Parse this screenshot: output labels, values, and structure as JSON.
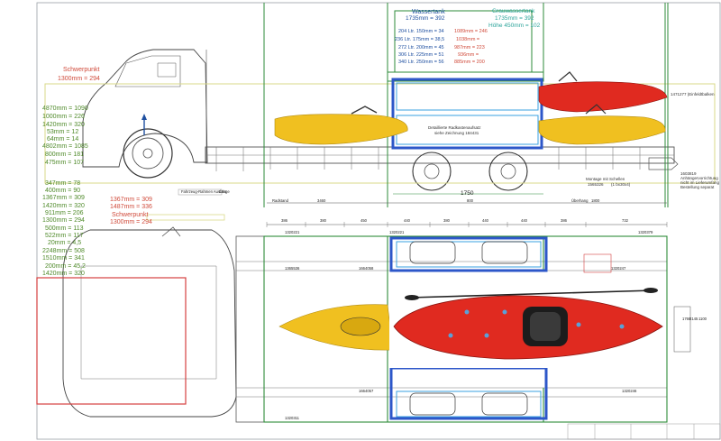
{
  "colors": {
    "frame_green": "#2e8b3a",
    "guide_yellow": "#d9d98a",
    "tank_blue": "#2d57c9",
    "tank_light": "#3aa0e0",
    "kayak_red": "#e02a20",
    "kayak_yellow": "#f0c020",
    "outline_red": "#d64040",
    "label_green": "#4f8a2a",
    "label_red": "#d04a3a",
    "label_teal": "#2aa39a",
    "label_blue": "#1e4fa0"
  },
  "left_labels": {
    "schwerpunkt_top": "Schwerpunkt",
    "schwerpunkt_top_value": "1300mm = 294",
    "list_green": [
      "4870mm = 1090",
      "1000mm = 226",
      "1420mm = 320",
      "53mm = 12",
      "64mm = 14",
      "4802mm = 1085",
      "800mm = 181",
      "475mm = 107"
    ],
    "list_green_lower": [
      "347mm = 78",
      "400mm = 90",
      "1367mm = 309",
      "1420mm = 320",
      "911mm = 206",
      "1300mm = 294",
      "500mm = 113",
      "522mm = 117",
      "20mm = 4,5",
      "2248mm = 508",
      "1510mm = 341",
      "200mm = 45,2",
      "1420mm = 320"
    ],
    "list_red_mid": [
      "1367mm = 309",
      "1487mm = 336"
    ],
    "schwerpunkt_mid": "Schwerpunkt",
    "schwerpunkt_mid_value": "1300mm = 294"
  },
  "wassertank": {
    "title": "Wassertank",
    "subtitle": "1735mm = 392",
    "rows": [
      "204 Ltr. 150mm = 34",
      "236 Ltr. 175mm = 38,5",
      "272 Ltr. 200mm = 45",
      "306 Ltr. 225mm = 51",
      "340 Ltr. 250mm = 56"
    ],
    "rows_right": [
      "1089mm = 246",
      "1038mm =",
      "987mm = 223",
      "936mm =",
      "885mm = 200"
    ]
  },
  "grauwassertank": {
    "title": "Grauwassertank",
    "line1": "1735mm = 392",
    "line2": "Höhe 450mm = 102"
  },
  "drawing_notes": {
    "detail_note_1": "Detaillierte Radkastenaufsatz",
    "detail_note_2": "siehe Zeichnung 184431",
    "part_right": "1471277 (Einfeldtbalken",
    "montage_1": "Montage mit Schellen",
    "montage_2": "1565326",
    "montage_3": "(1 bx30x4)",
    "note_right_1": "1603819",
    "note_right_2": "Anhängervorrichtung",
    "note_right_3": "nicht im Lieferumfang",
    "note_right_4": "Bestellung separat",
    "dim_1750": "1750",
    "dim_800": "800",
    "dim_1800": "1800",
    "dim_3460": "3460",
    "radstand": "Radstand",
    "ueberhang": "Überhang",
    "frame_label": "Fahrzeug-Rahmen Ausfahr",
    "frame_label_2": "Länge"
  },
  "top_dims": [
    "386",
    "380",
    "450",
    "440",
    "380",
    "440",
    "440",
    "386",
    "732"
  ],
  "plan_part_ids": [
    "1320221",
    "1320221",
    "1320379",
    "1365536",
    "1664058",
    "1320247",
    "1664057",
    "1320246",
    "1320311"
  ],
  "plan_side_dims": [
    "1766",
    "2145",
    "1100"
  ]
}
